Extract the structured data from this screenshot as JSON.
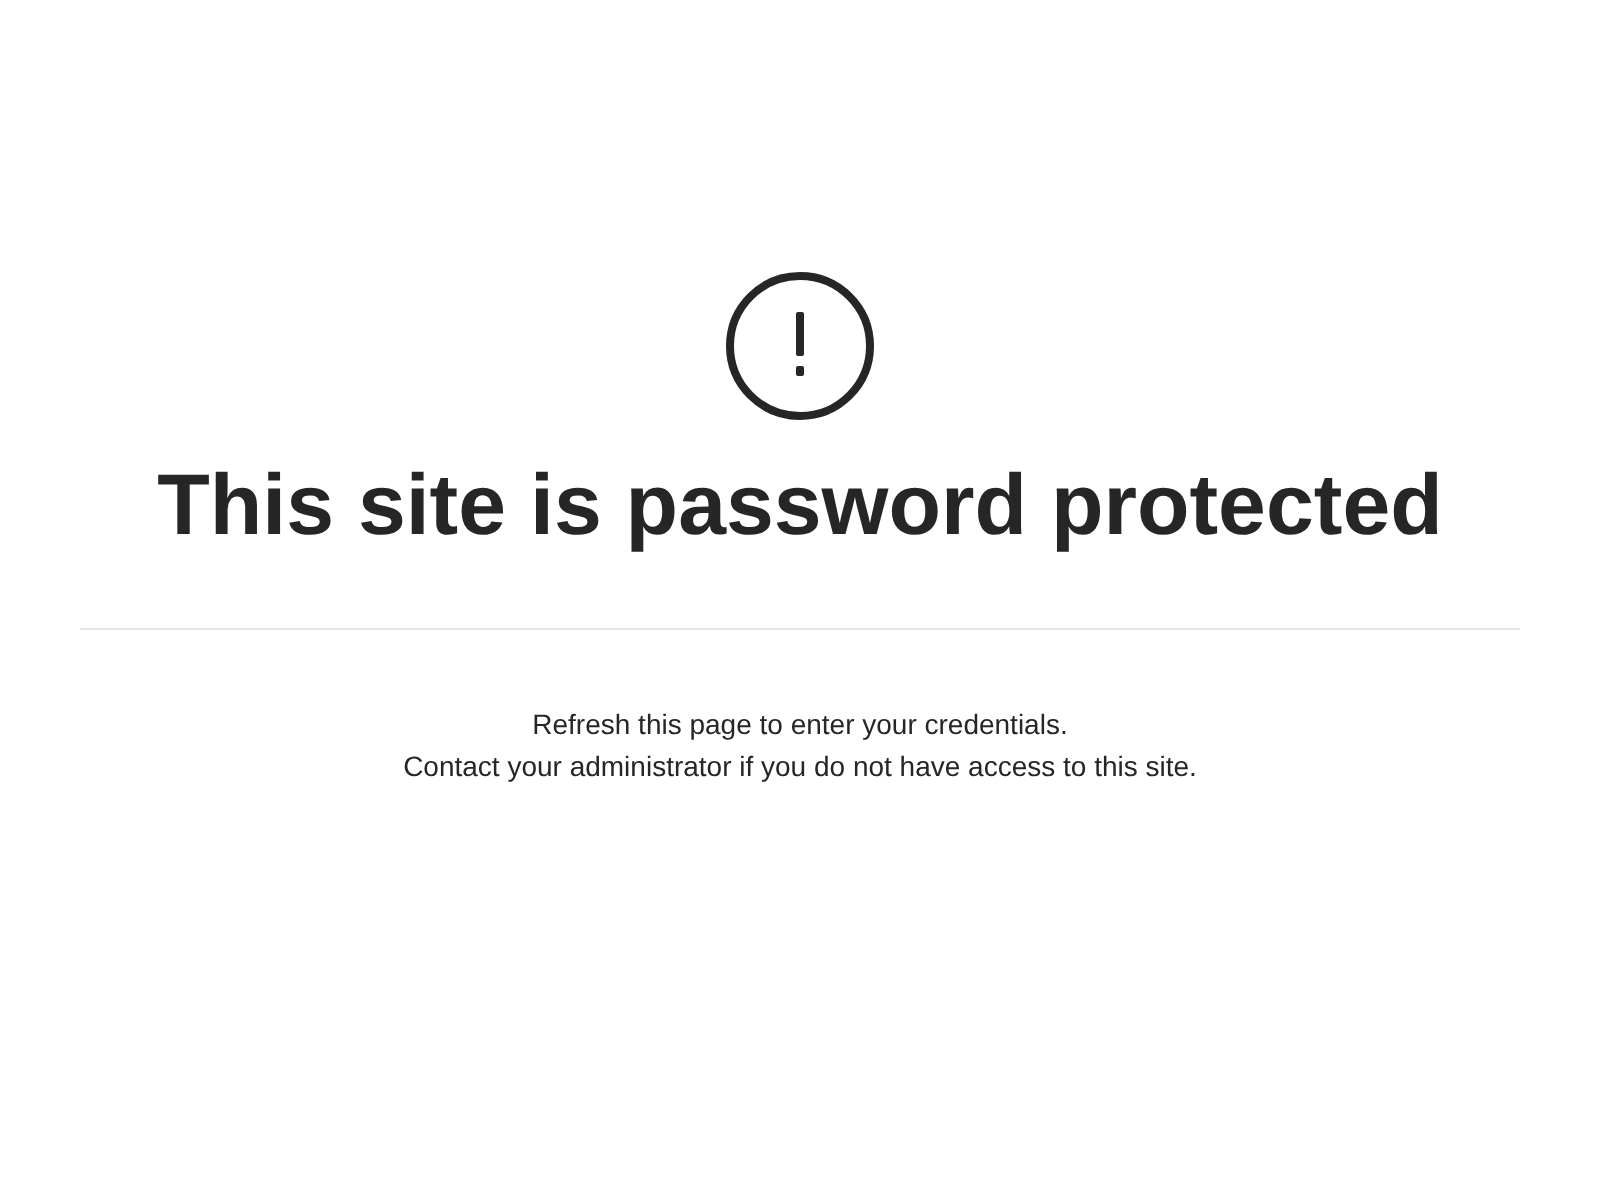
{
  "heading": "This site is password protected",
  "message_lines": [
    "Refresh this page to enter your credentials.",
    "Contact your administrator if you do not have access to this site."
  ]
}
